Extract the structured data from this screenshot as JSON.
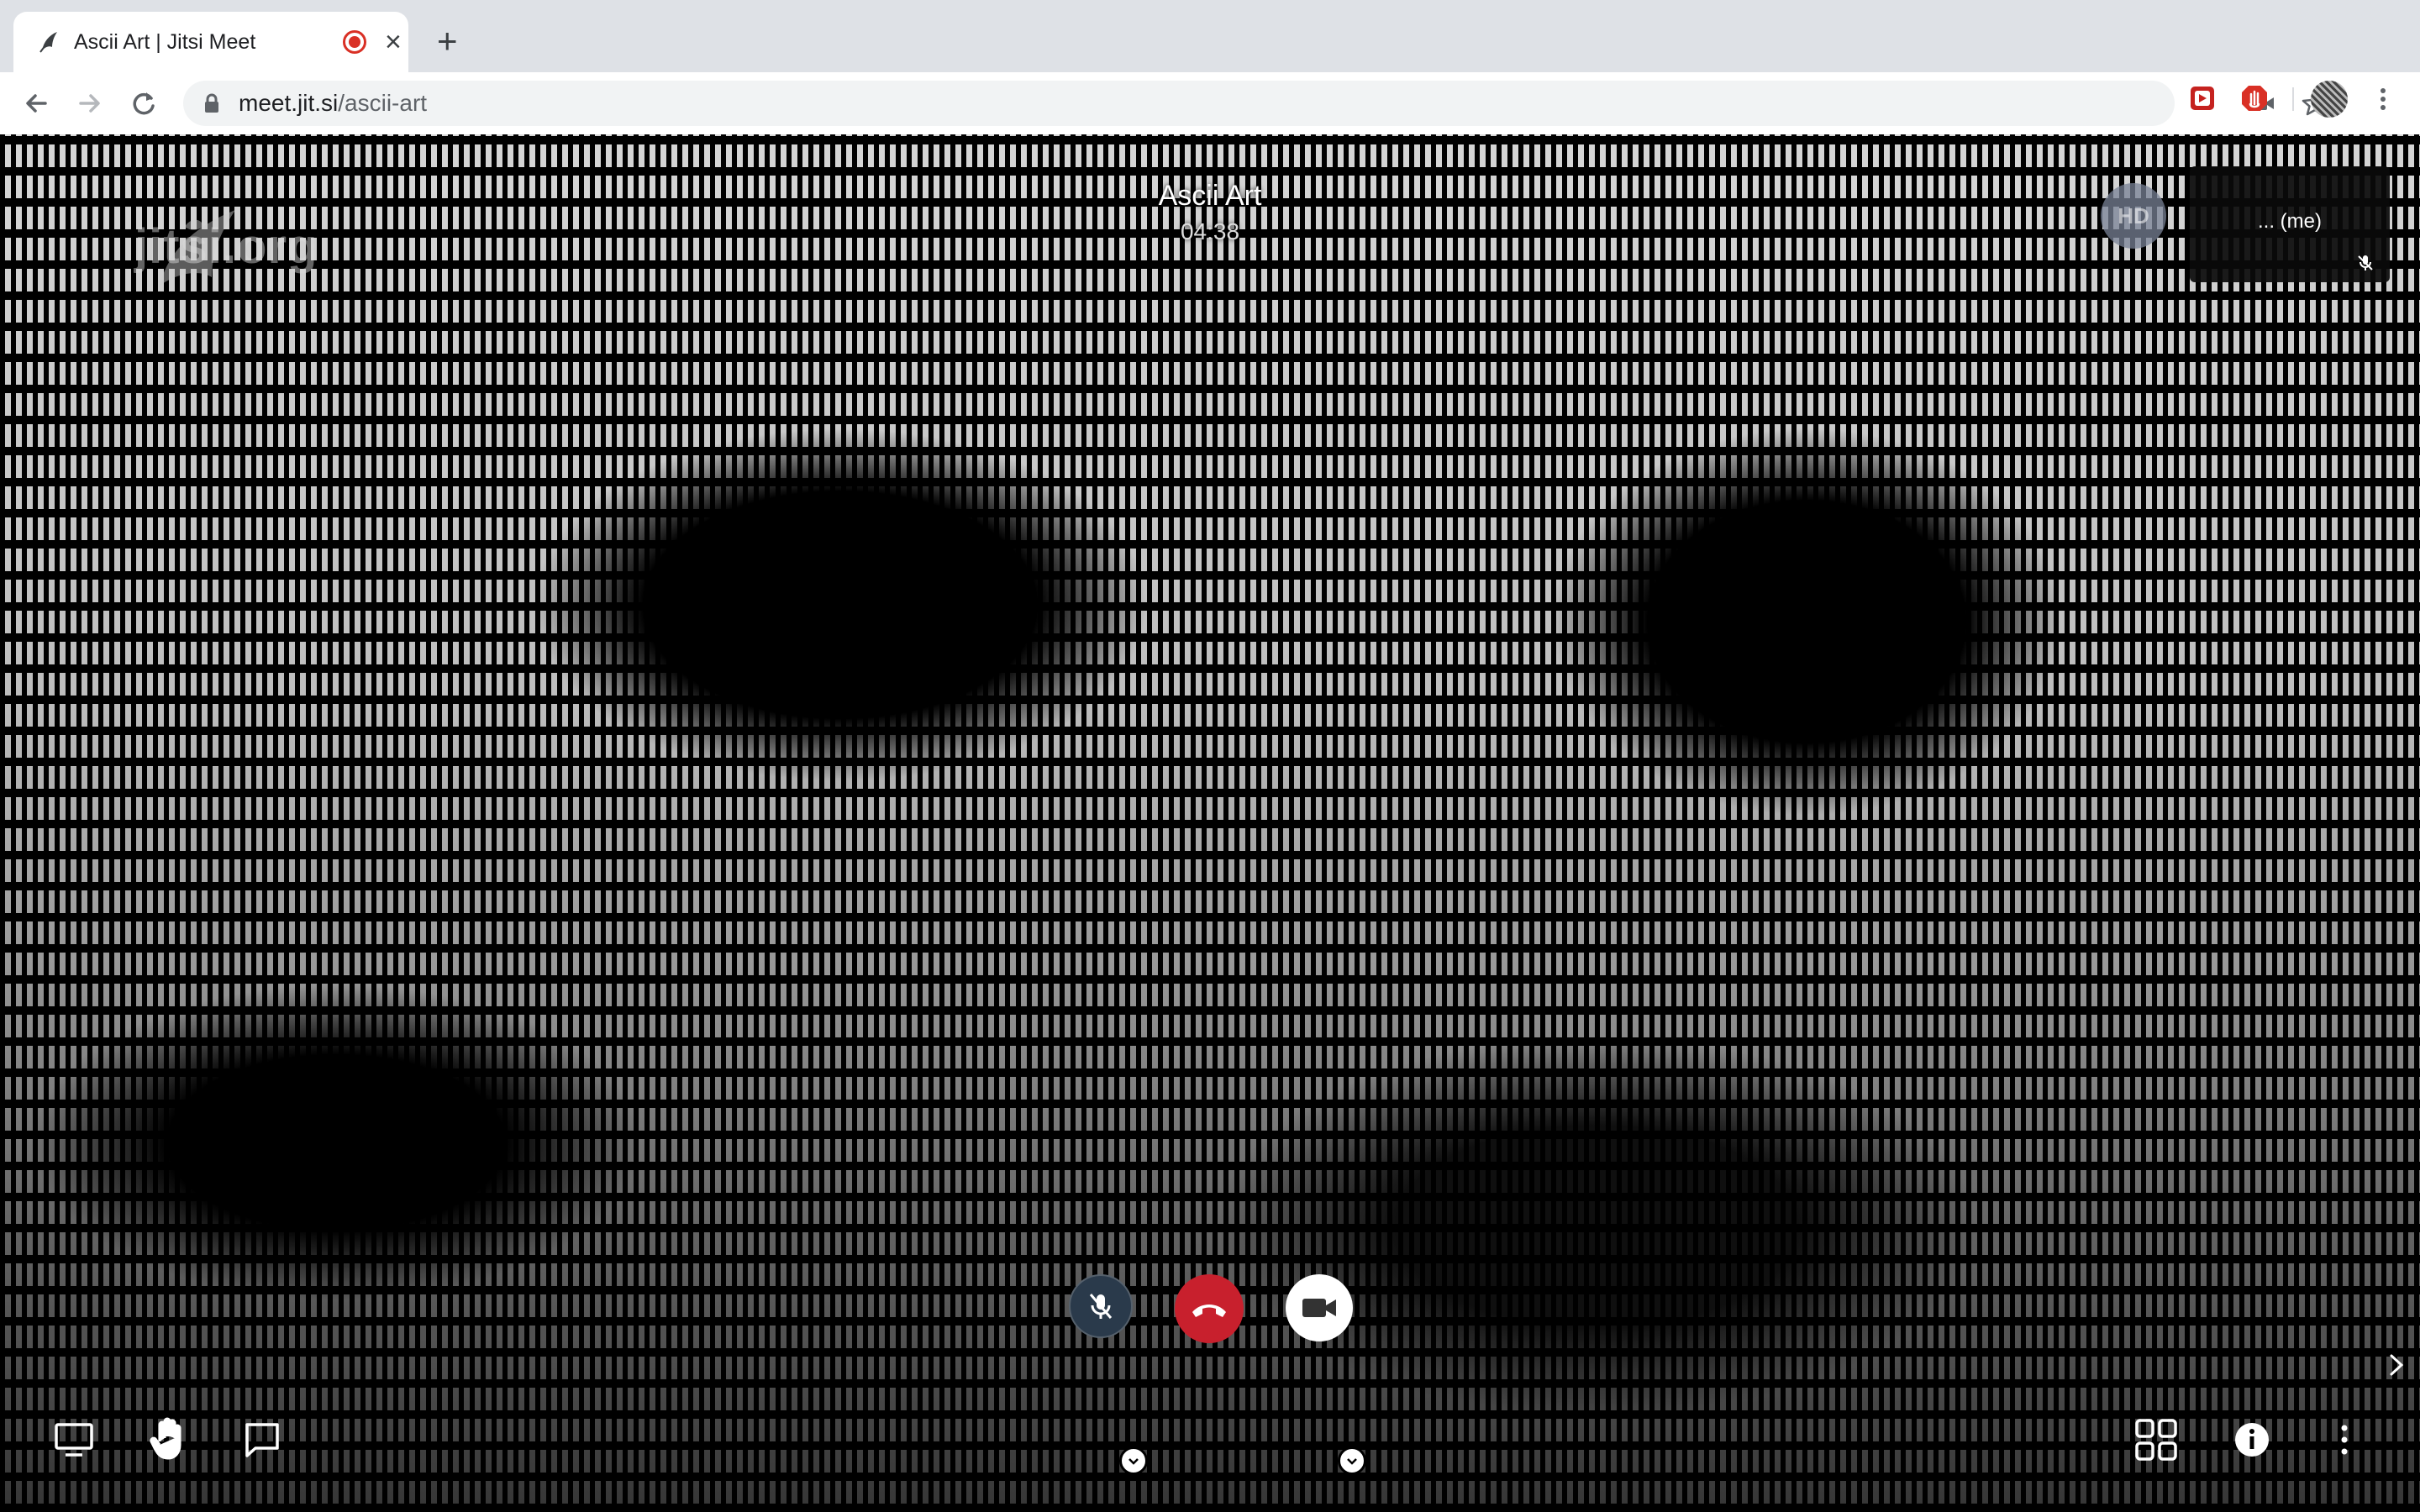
{
  "browser": {
    "tab_title": "Ascii Art | Jitsi Meet",
    "new_tab_label": "+",
    "tab_close_label": "×",
    "url_host": "meet.jit.si",
    "url_path": "/ascii-art"
  },
  "meeting": {
    "title": "Ascii Art",
    "timer": "04:38",
    "watermark": "jitsi.org",
    "hd_badge": "HD",
    "local_participant": "... (me)"
  },
  "toolbox": {
    "left": [
      "screenshare-icon",
      "raise-hand-icon",
      "chat-icon"
    ],
    "center": [
      "microphone-muted-icon",
      "hangup-icon",
      "camera-icon"
    ],
    "right": [
      "tile-view-icon",
      "info-icon",
      "more-actions-icon"
    ]
  },
  "colors": {
    "hangup": "#c8202d",
    "mic_button": "#2a3a4b",
    "chrome_tabbar": "#dee1e6",
    "recording": "#d93025"
  }
}
